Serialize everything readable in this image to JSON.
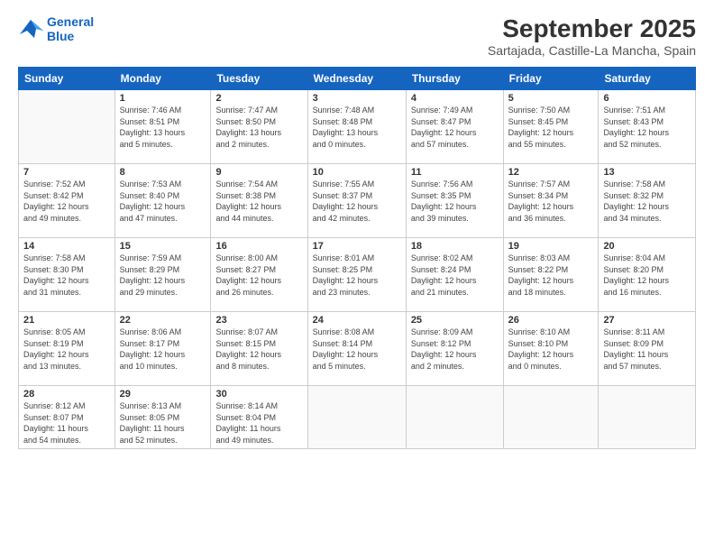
{
  "header": {
    "logo_line1": "General",
    "logo_line2": "Blue",
    "title": "September 2025",
    "subtitle": "Sartajada, Castille-La Mancha, Spain"
  },
  "weekdays": [
    "Sunday",
    "Monday",
    "Tuesday",
    "Wednesday",
    "Thursday",
    "Friday",
    "Saturday"
  ],
  "weeks": [
    [
      {
        "day": "",
        "info": ""
      },
      {
        "day": "1",
        "info": "Sunrise: 7:46 AM\nSunset: 8:51 PM\nDaylight: 13 hours\nand 5 minutes."
      },
      {
        "day": "2",
        "info": "Sunrise: 7:47 AM\nSunset: 8:50 PM\nDaylight: 13 hours\nand 2 minutes."
      },
      {
        "day": "3",
        "info": "Sunrise: 7:48 AM\nSunset: 8:48 PM\nDaylight: 13 hours\nand 0 minutes."
      },
      {
        "day": "4",
        "info": "Sunrise: 7:49 AM\nSunset: 8:47 PM\nDaylight: 12 hours\nand 57 minutes."
      },
      {
        "day": "5",
        "info": "Sunrise: 7:50 AM\nSunset: 8:45 PM\nDaylight: 12 hours\nand 55 minutes."
      },
      {
        "day": "6",
        "info": "Sunrise: 7:51 AM\nSunset: 8:43 PM\nDaylight: 12 hours\nand 52 minutes."
      }
    ],
    [
      {
        "day": "7",
        "info": "Sunrise: 7:52 AM\nSunset: 8:42 PM\nDaylight: 12 hours\nand 49 minutes."
      },
      {
        "day": "8",
        "info": "Sunrise: 7:53 AM\nSunset: 8:40 PM\nDaylight: 12 hours\nand 47 minutes."
      },
      {
        "day": "9",
        "info": "Sunrise: 7:54 AM\nSunset: 8:38 PM\nDaylight: 12 hours\nand 44 minutes."
      },
      {
        "day": "10",
        "info": "Sunrise: 7:55 AM\nSunset: 8:37 PM\nDaylight: 12 hours\nand 42 minutes."
      },
      {
        "day": "11",
        "info": "Sunrise: 7:56 AM\nSunset: 8:35 PM\nDaylight: 12 hours\nand 39 minutes."
      },
      {
        "day": "12",
        "info": "Sunrise: 7:57 AM\nSunset: 8:34 PM\nDaylight: 12 hours\nand 36 minutes."
      },
      {
        "day": "13",
        "info": "Sunrise: 7:58 AM\nSunset: 8:32 PM\nDaylight: 12 hours\nand 34 minutes."
      }
    ],
    [
      {
        "day": "14",
        "info": "Sunrise: 7:58 AM\nSunset: 8:30 PM\nDaylight: 12 hours\nand 31 minutes."
      },
      {
        "day": "15",
        "info": "Sunrise: 7:59 AM\nSunset: 8:29 PM\nDaylight: 12 hours\nand 29 minutes."
      },
      {
        "day": "16",
        "info": "Sunrise: 8:00 AM\nSunset: 8:27 PM\nDaylight: 12 hours\nand 26 minutes."
      },
      {
        "day": "17",
        "info": "Sunrise: 8:01 AM\nSunset: 8:25 PM\nDaylight: 12 hours\nand 23 minutes."
      },
      {
        "day": "18",
        "info": "Sunrise: 8:02 AM\nSunset: 8:24 PM\nDaylight: 12 hours\nand 21 minutes."
      },
      {
        "day": "19",
        "info": "Sunrise: 8:03 AM\nSunset: 8:22 PM\nDaylight: 12 hours\nand 18 minutes."
      },
      {
        "day": "20",
        "info": "Sunrise: 8:04 AM\nSunset: 8:20 PM\nDaylight: 12 hours\nand 16 minutes."
      }
    ],
    [
      {
        "day": "21",
        "info": "Sunrise: 8:05 AM\nSunset: 8:19 PM\nDaylight: 12 hours\nand 13 minutes."
      },
      {
        "day": "22",
        "info": "Sunrise: 8:06 AM\nSunset: 8:17 PM\nDaylight: 12 hours\nand 10 minutes."
      },
      {
        "day": "23",
        "info": "Sunrise: 8:07 AM\nSunset: 8:15 PM\nDaylight: 12 hours\nand 8 minutes."
      },
      {
        "day": "24",
        "info": "Sunrise: 8:08 AM\nSunset: 8:14 PM\nDaylight: 12 hours\nand 5 minutes."
      },
      {
        "day": "25",
        "info": "Sunrise: 8:09 AM\nSunset: 8:12 PM\nDaylight: 12 hours\nand 2 minutes."
      },
      {
        "day": "26",
        "info": "Sunrise: 8:10 AM\nSunset: 8:10 PM\nDaylight: 12 hours\nand 0 minutes."
      },
      {
        "day": "27",
        "info": "Sunrise: 8:11 AM\nSunset: 8:09 PM\nDaylight: 11 hours\nand 57 minutes."
      }
    ],
    [
      {
        "day": "28",
        "info": "Sunrise: 8:12 AM\nSunset: 8:07 PM\nDaylight: 11 hours\nand 54 minutes."
      },
      {
        "day": "29",
        "info": "Sunrise: 8:13 AM\nSunset: 8:05 PM\nDaylight: 11 hours\nand 52 minutes."
      },
      {
        "day": "30",
        "info": "Sunrise: 8:14 AM\nSunset: 8:04 PM\nDaylight: 11 hours\nand 49 minutes."
      },
      {
        "day": "",
        "info": ""
      },
      {
        "day": "",
        "info": ""
      },
      {
        "day": "",
        "info": ""
      },
      {
        "day": "",
        "info": ""
      }
    ]
  ]
}
